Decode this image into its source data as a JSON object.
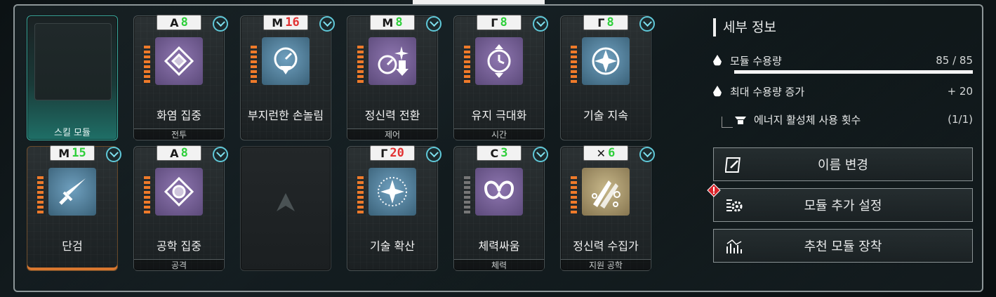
{
  "cards": [
    {
      "id": "c1",
      "label": "",
      "sub": "스킬 모듈",
      "badge_num": "",
      "variant": "teal"
    },
    {
      "id": "c2",
      "label": "화염 집중",
      "sub": "전투",
      "badge_icon": "A",
      "badge_num": "8",
      "num_color": "green",
      "icon": "purple",
      "bars": "orange"
    },
    {
      "id": "c3",
      "label": "부지런한 손놀림",
      "sub": "",
      "badge_icon": "M",
      "badge_num": "16",
      "num_color": "red",
      "icon": "blue",
      "bars": "orange"
    },
    {
      "id": "c4",
      "label": "정신력 전환",
      "sub": "제어",
      "badge_icon": "M",
      "badge_num": "8",
      "num_color": "green",
      "icon": "purple",
      "bars": "orange"
    },
    {
      "id": "c5",
      "label": "유지 극대화",
      "sub": "시간",
      "badge_icon": "Γ",
      "badge_num": "8",
      "num_color": "green",
      "icon": "purple",
      "bars": "orange"
    },
    {
      "id": "c6",
      "label": "기술 지속",
      "sub": "",
      "badge_icon": "Γ",
      "badge_num": "8",
      "num_color": "green",
      "icon": "blue",
      "bars": "orange"
    },
    {
      "id": "c7",
      "label": "단검",
      "sub": "",
      "badge_icon": "M",
      "badge_num": "15",
      "num_color": "green",
      "icon": "blue",
      "bars": "orange",
      "variant": "orange"
    },
    {
      "id": "c8",
      "label": "공학 집중",
      "sub": "공격",
      "badge_icon": "A",
      "badge_num": "8",
      "num_color": "green",
      "icon": "purple",
      "bars": "orange"
    },
    {
      "id": "c9",
      "label": "",
      "sub": "",
      "variant": "empty"
    },
    {
      "id": "c10",
      "label": "기술 확산",
      "sub": "",
      "badge_icon": "Γ",
      "badge_num": "20",
      "num_color": "red",
      "icon": "blue",
      "bars": "orange"
    },
    {
      "id": "c11",
      "label": "체력싸움",
      "sub": "체력",
      "badge_icon": "C",
      "badge_num": "3",
      "num_color": "green",
      "icon": "purple",
      "bars": "grey"
    },
    {
      "id": "c12",
      "label": "정신력 수집가",
      "sub": "지원 공학",
      "badge_icon": "✕",
      "badge_num": "6",
      "num_color": "green",
      "icon": "gold",
      "bars": "orange"
    }
  ],
  "panel": {
    "title": "세부 정보",
    "capacity_label": "모듈 수용량",
    "capacity_value": "85 / 85",
    "capacity_fraction": 1.0,
    "max_increase_label": "최대 수용량 증가",
    "max_increase_value": "+ 20",
    "energy_label": "에너지 활성체 사용 횟수",
    "energy_value": "(1/1)"
  },
  "buttons": {
    "rename": "이름 변경",
    "add_settings": "모듈 추가 설정",
    "recommend": "추천 모듈 장착"
  },
  "colors": {
    "accent_teal": "#3aa89c",
    "badge_green": "#2ecf3a",
    "badge_red": "#e23232",
    "bar_orange": "#ef7a2a",
    "alert_red": "#d8232a"
  }
}
